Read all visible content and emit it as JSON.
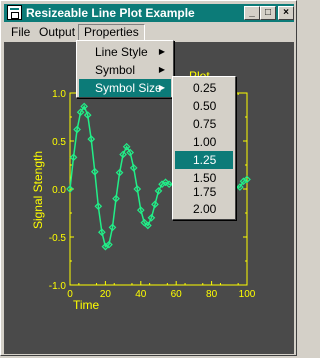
{
  "window": {
    "title": "Resizeable Line Plot Example"
  },
  "titlebar_buttons": {
    "minimize": "_",
    "maximize": "□",
    "close": "×"
  },
  "menu": {
    "file": "File",
    "output": "Output",
    "properties": "Properties"
  },
  "properties_menu": {
    "items": [
      "Line Style",
      "Symbol",
      "Symbol Size"
    ],
    "selected": "Symbol Size"
  },
  "symbol_size_menu": {
    "items": [
      "0.25",
      "0.50",
      "0.75",
      "1.00",
      "1.25",
      "1.50",
      "1.75",
      "2.00"
    ],
    "selected": "1.25"
  },
  "partial_label": "Plot",
  "colors": {
    "axis": "#ffff00",
    "series": "#22ee88",
    "background": "#4a4a4a",
    "highlight": "#0c7b78"
  },
  "chart_data": {
    "type": "line",
    "title": "",
    "xlabel": "Time",
    "ylabel": "Signal Stength",
    "xlim": [
      0,
      100
    ],
    "ylim": [
      -1.0,
      1.0
    ],
    "xticks": [
      "0",
      "20",
      "40",
      "60",
      "80",
      "100"
    ],
    "yticks": [
      "1.0",
      "0.5",
      "0.0",
      "-0.5",
      "-1.0"
    ],
    "series": [
      {
        "x": [
          0,
          2,
          4,
          6,
          8,
          10,
          12,
          14,
          16,
          18,
          20,
          22,
          24,
          26,
          28,
          30,
          32,
          34,
          36,
          38,
          40,
          42,
          44,
          46,
          48,
          50,
          52,
          54,
          56,
          96,
          98,
          100
        ],
        "y": [
          0.0,
          0.33,
          0.62,
          0.8,
          0.86,
          0.77,
          0.52,
          0.18,
          -0.18,
          -0.45,
          -0.6,
          -0.58,
          -0.4,
          -0.1,
          0.17,
          0.36,
          0.44,
          0.38,
          0.22,
          0.0,
          -0.22,
          -0.35,
          -0.38,
          -0.3,
          -0.16,
          -0.02,
          0.05,
          0.07,
          0.05,
          0.02,
          0.08,
          0.1
        ]
      }
    ]
  }
}
